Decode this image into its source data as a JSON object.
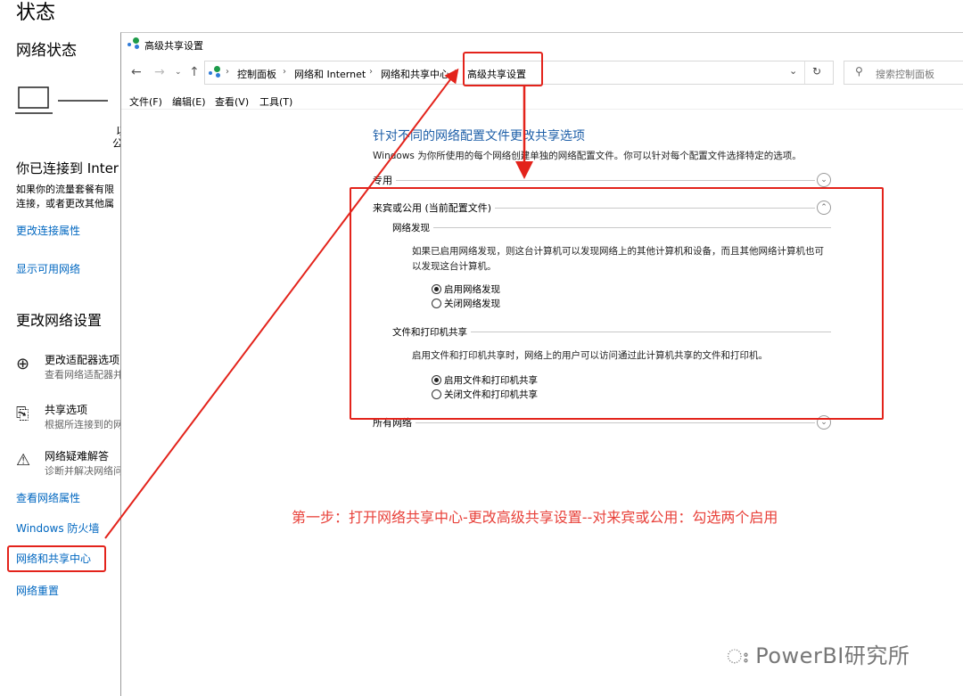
{
  "settings": {
    "title": "状态",
    "subtitle": "网络状态",
    "status_line1": "以",
    "status_line2": "公",
    "connected_heading": "你已连接到 Inter",
    "connected_desc1": "如果你的流量套餐有限",
    "connected_desc2": "连接，或者更改其他属",
    "link_change_props": "更改连接属性",
    "link_show_networks": "显示可用网络",
    "change_heading": "更改网络设置",
    "adapter_title": "更改适配器选项",
    "adapter_desc": "查看网络适配器并",
    "sharing_title": "共享选项",
    "sharing_desc": "根据所连接到的网",
    "troubleshoot_title": "网络疑难解答",
    "troubleshoot_desc": "诊断并解决网络问",
    "link_view_props": "查看网络属性",
    "link_firewall": "Windows 防火墙",
    "link_sharing_center": "网络和共享中心",
    "link_reset": "网络重置"
  },
  "window": {
    "title": "高级共享设置",
    "breadcrumb": [
      "控制面板",
      "网络和 Internet",
      "网络和共享中心",
      "高级共享设置"
    ],
    "search_placeholder": "搜索控制面板",
    "menu": [
      "文件(F)",
      "编辑(E)",
      "查看(V)",
      "工具(T)"
    ]
  },
  "content": {
    "heading": "针对不同的网络配置文件更改共享选项",
    "description": "Windows 为你所使用的每个网络创建单独的网络配置文件。你可以针对每个配置文件选择特定的选项。",
    "private_label": "专用",
    "guest_label": "来宾或公用 (当前配置文件)",
    "discovery_label": "网络发现",
    "discovery_para": "如果已启用网络发现，则这台计算机可以发现网络上的其他计算机和设备，而且其他网络计算机也可以发现这台计算机。",
    "discovery_on": "启用网络发现",
    "discovery_off": "关闭网络发现",
    "fileprint_label": "文件和打印机共享",
    "fileprint_para": "启用文件和打印机共享时，网络上的用户可以访问通过此计算机共享的文件和打印机。",
    "fileprint_on": "启用文件和打印机共享",
    "fileprint_off": "关闭文件和打印机共享",
    "all_label": "所有网络"
  },
  "annotation": "第一步：打开网络共享中心-更改高级共享设置--对来宾或公用：勾选两个启用",
  "watermark": "PowerBI研究所",
  "colors": {
    "annotation": "#e8413a",
    "link": "#0067c0",
    "heading": "#1e5fa8"
  }
}
